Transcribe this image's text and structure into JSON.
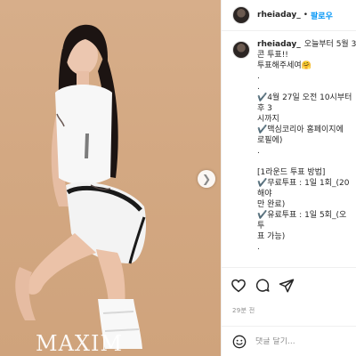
{
  "post": {
    "watermark": "MAXIM",
    "next_glyph": "❯"
  },
  "header": {
    "username": "rheiaday_",
    "separator": "•",
    "follow_label": "팔로우"
  },
  "caption": {
    "username": "rheiaday_",
    "lines": [
      "오늘부터 5월 3",
      "콘 투표!!",
      "투표해주세여🤗",
      ".",
      ".",
      "✔️4월 27일 오전 10시부터",
      "후 3",
      "시까지",
      "✔️맥심코리아 홈페이지에",
      "로필에)",
      ".",
      "",
      "[1라운드 투표 방법]",
      "✔️무료투표 : 1일 1회_(20",
      "해야",
      "만 완료)",
      "✔️유료투표 : 1일 5회_(오",
      "투",
      "표 가능)",
      "."
    ]
  },
  "actions": {
    "like_icon": "heart-icon",
    "comment_icon": "comment-icon",
    "share_icon": "share-icon"
  },
  "timestamp": "29분 전",
  "comment": {
    "placeholder": "댓글 달기..."
  }
}
